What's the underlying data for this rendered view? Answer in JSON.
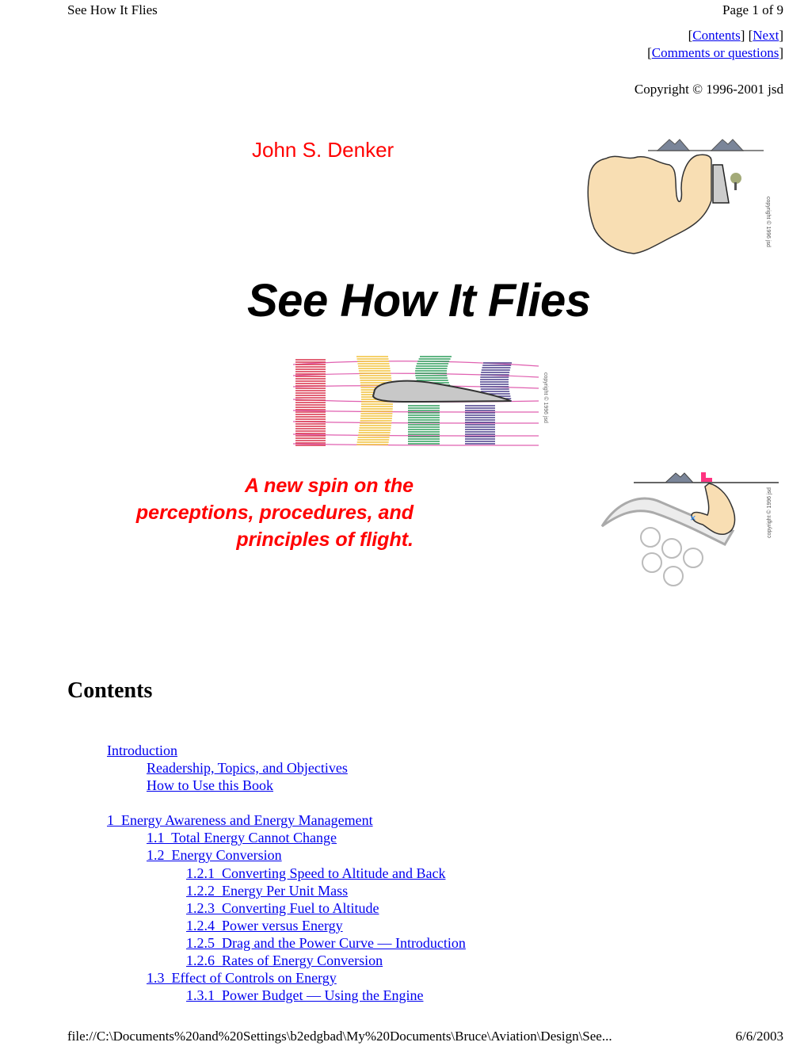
{
  "header": {
    "doc_title": "See How It Flies",
    "page_indicator": "Page 1 of 9"
  },
  "nav": {
    "contents_label": "Contents",
    "next_label": "Next",
    "comments_label": "Comments or questions",
    "open_bracket": "[",
    "close_bracket": "]"
  },
  "copyright": "Copyright © 1996-2001 jsd",
  "author": "John S. Denker",
  "title": "See How It Flies",
  "tagline": [
    "A new spin on the",
    "perceptions, procedures, and",
    "principles of flight."
  ],
  "images": {
    "hand_horizon": {
      "name": "hand-horizon-illustration",
      "caption": "copyright © 1996 jsd"
    },
    "airfoil_flow": {
      "name": "airfoil-streamlines-illustration",
      "caption": "copyright © 1996 jsd"
    },
    "hand_slope": {
      "name": "hand-slope-illustration",
      "caption": "copyright © 1996 jsd"
    }
  },
  "contents": {
    "heading": "Contents",
    "items": [
      {
        "level": 0,
        "label": "Introduction"
      },
      {
        "level": 1,
        "label": "Readership, Topics, and Objectives"
      },
      {
        "level": 1,
        "label": "How to Use this Book"
      },
      {
        "level": -1,
        "label": ""
      },
      {
        "level": 0,
        "label": "1  Energy Awareness and Energy Management"
      },
      {
        "level": 1,
        "label": "1.1  Total Energy Cannot Change"
      },
      {
        "level": 1,
        "label": "1.2  Energy Conversion"
      },
      {
        "level": 2,
        "label": "1.2.1  Converting Speed to Altitude and Back"
      },
      {
        "level": 2,
        "label": "1.2.2  Energy Per Unit Mass"
      },
      {
        "level": 2,
        "label": "1.2.3  Converting Fuel to Altitude"
      },
      {
        "level": 2,
        "label": "1.2.4  Power versus Energy"
      },
      {
        "level": 2,
        "label": "1.2.5  Drag and the Power Curve — Introduction"
      },
      {
        "level": 2,
        "label": "1.2.6  Rates of Energy Conversion"
      },
      {
        "level": 1,
        "label": "1.3  Effect of Controls on Energy"
      },
      {
        "level": 2,
        "label": "1.3.1  Power Budget — Using the Engine"
      }
    ]
  },
  "footer": {
    "path": "file://C:\\Documents%20and%20Settings\\b2edgbad\\My%20Documents\\Bruce\\Aviation\\Design\\See...",
    "date": "6/6/2003"
  },
  "colors": {
    "link": "#0000ee",
    "accent_red": "#ff0000",
    "skin": "#f8deb3",
    "mountain": "#7a8599"
  }
}
